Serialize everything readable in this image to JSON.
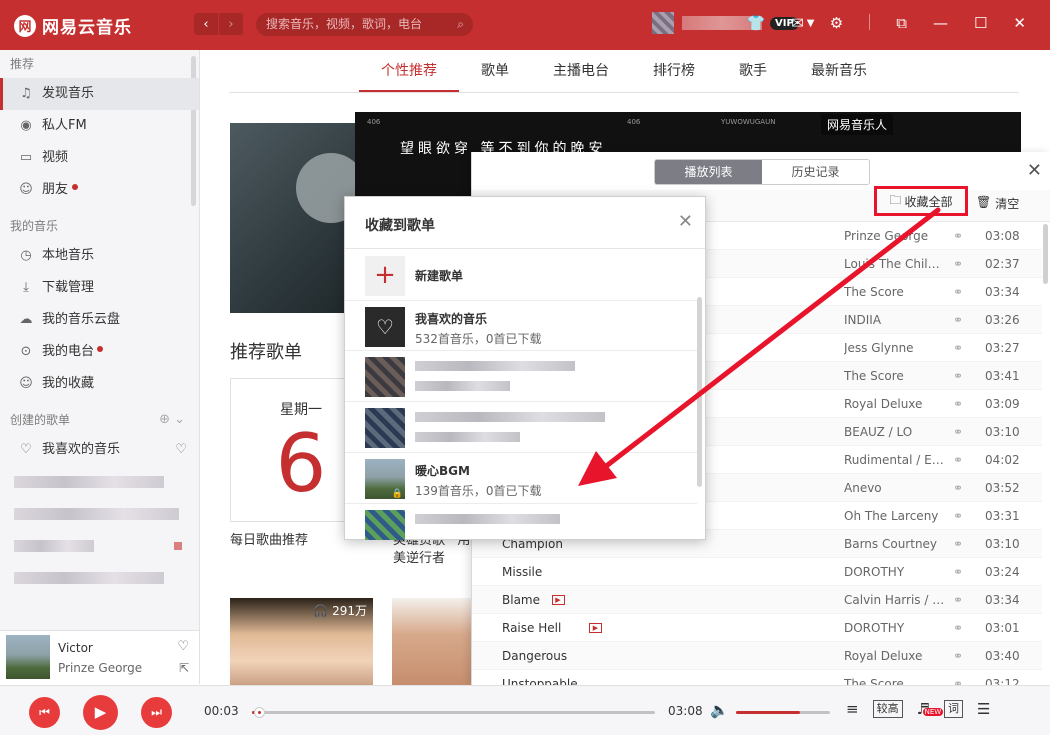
{
  "app": {
    "logo_mark": "网",
    "title": "网易云音乐"
  },
  "header": {
    "back_arrow": "‹",
    "forward_arrow": "›",
    "search_placeholder": "搜索音乐，视频，歌词，电台",
    "vip_badge": "VIP",
    "icons": [
      "skin-icon",
      "mail-icon",
      "settings-icon",
      "mini-mode-icon",
      "minimize-icon",
      "maximize-icon",
      "close-icon"
    ]
  },
  "sidebar": {
    "sec1_title": "推荐",
    "sec1_items": [
      {
        "label": "发现音乐",
        "icon": "♫",
        "active": true
      },
      {
        "label": "私人FM",
        "icon": "◉"
      },
      {
        "label": "视频",
        "icon": "▭"
      },
      {
        "label": "朋友",
        "icon": "☺",
        "dot": true
      }
    ],
    "sec2_title": "我的音乐",
    "sec2_items": [
      {
        "label": "本地音乐",
        "icon": "◷"
      },
      {
        "label": "下载管理",
        "icon": "⤓"
      },
      {
        "label": "我的音乐云盘",
        "icon": "☁"
      },
      {
        "label": "我的电台",
        "icon": "⊙",
        "dot": true
      },
      {
        "label": "我的收藏",
        "icon": "☺"
      }
    ],
    "sec3_title": "创建的歌单",
    "sec3_first": "我喜欢的音乐"
  },
  "now_playing": {
    "title": "Victor",
    "artist": "Prinze George"
  },
  "main": {
    "tabs": [
      "个性推荐",
      "歌单",
      "主播电台",
      "排行榜",
      "歌手",
      "最新音乐"
    ],
    "banner_caption": "望眼欲穿 等不到你的晚安",
    "banner_small1": "406",
    "banner_small2": "406",
    "banner_small3": "YUWOWUGAUN",
    "banner_badge": "网易音乐人",
    "rec_title": "推荐歌单",
    "daily_week": "星期一",
    "daily_day": "6",
    "daily_label": "每日歌曲推荐",
    "card2_label1": "英雄资歌 · 用",
    "card2_label2": "美逆行者",
    "plays": "291万"
  },
  "playlist": {
    "tab_active": "播放列表",
    "tab_history": "历史记录",
    "collect_all": "收藏全部",
    "clear": "清空",
    "rows": [
      {
        "title": "",
        "artist": "Prinze George",
        "duration": "03:08"
      },
      {
        "title": "",
        "artist": "Louis The Child ...",
        "duration": "02:37"
      },
      {
        "title": "",
        "artist": "The Score",
        "duration": "03:34"
      },
      {
        "title": "",
        "artist": "INDIIA",
        "duration": "03:26"
      },
      {
        "title": "",
        "artist": "Jess Glynne",
        "duration": "03:27"
      },
      {
        "title": "",
        "artist": "The Score",
        "duration": "03:41"
      },
      {
        "title": "",
        "artist": "Royal Deluxe",
        "duration": "03:09"
      },
      {
        "title": "",
        "artist": "BEAUZ / LO",
        "duration": "03:10"
      },
      {
        "title": "",
        "artist": "Rudimental / Ed...",
        "duration": "04:02"
      },
      {
        "title": "",
        "artist": "Anevo",
        "duration": "03:52"
      },
      {
        "title": "",
        "artist": "Oh The Larceny",
        "duration": "03:31"
      },
      {
        "title": "Champion",
        "artist": "Barns Courtney",
        "duration": "03:10"
      },
      {
        "title": "Missile",
        "artist": "DOROTHY",
        "duration": "03:24"
      },
      {
        "title": "Blame",
        "artist": "Calvin Harris / J...",
        "duration": "03:34",
        "mv": true
      },
      {
        "title": "Raise Hell",
        "artist": "DOROTHY",
        "duration": "03:01",
        "mv": true
      },
      {
        "title": "Dangerous",
        "artist": "Royal Deluxe",
        "duration": "03:40"
      },
      {
        "title": "Unstoppable",
        "artist": "The Score",
        "duration": "03:12"
      }
    ]
  },
  "dialog": {
    "title": "收藏到歌单",
    "new_playlist": "新建歌单",
    "liked_name": "我喜欢的音乐",
    "liked_meta": "532首音乐，0首已下载",
    "bgm_name": "暖心BGM",
    "bgm_meta": "139首音乐，0首已下载"
  },
  "player": {
    "time_current": "00:03",
    "time_total": "03:08",
    "progress": 0.01,
    "volume": 0.68,
    "quality": "较高",
    "lyrics": "词"
  }
}
